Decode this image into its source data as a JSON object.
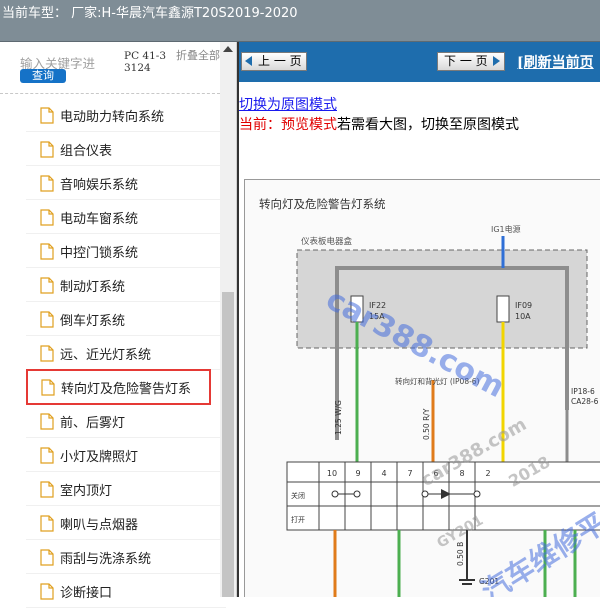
{
  "titlebar": {
    "title": "当前车型： 厂家:H-华晨汽车鑫源T20S2019-2020"
  },
  "sidebar": {
    "search": {
      "placeholder": "输入关键字进",
      "button": "查询",
      "code": "PC 41-33124",
      "collapse_all": "折叠全部"
    },
    "items": [
      {
        "label": "电动助力转向系统"
      },
      {
        "label": "组合仪表"
      },
      {
        "label": "音响娱乐系统"
      },
      {
        "label": "电动车窗系统"
      },
      {
        "label": "中控门锁系统"
      },
      {
        "label": "制动灯系统"
      },
      {
        "label": "倒车灯系统"
      },
      {
        "label": "远、近光灯系统"
      },
      {
        "label": "转向灯及危险警告灯系"
      },
      {
        "label": "前、后雾灯"
      },
      {
        "label": "小灯及牌照灯"
      },
      {
        "label": "室内顶灯"
      },
      {
        "label": "喇叭与点烟器"
      },
      {
        "label": "雨刮与洗涤系统"
      },
      {
        "label": "诊断接口"
      }
    ],
    "selected_index": 8
  },
  "viewer": {
    "prev_label": "上 一 页",
    "next_label": "下 一 页",
    "refresh_label": "[刷新当前页",
    "switch_link": "切换为原图模式",
    "mode_prefix": "当前：预览模式",
    "mode_suffix": "若需看大图，切换至原图模式"
  },
  "diagram": {
    "title": "转向灯及危险警告灯系统",
    "box_label": "仪表板电器盒",
    "power_label": "IG1电源",
    "fuse1": {
      "id": "IF22",
      "amp": "15A"
    },
    "fuse2": {
      "id": "IF09",
      "amp": "10A"
    },
    "connector1": "IP18-6",
    "connector2": "CA28-6",
    "wire1": "1.25 W/G",
    "wire2": "0.50 R/Y",
    "wire3": "0.50 B",
    "ground": "G201",
    "note": "转向灯和背光灯 (IP08-6)",
    "pins": [
      "10",
      "9",
      "4",
      "7",
      "6",
      "8",
      "2"
    ],
    "row_off": "关闭",
    "row_on": "打开",
    "watermarks": [
      "car388.com",
      "car388.com",
      "汽车维修平",
      "2018",
      "GY201"
    ]
  },
  "colors": {
    "titlebar": "#7f8d96",
    "nav": "#1e6dad",
    "query_button": "#1572c7",
    "selected_outline": "#e53935",
    "wire_green": "#4caf50",
    "wire_orange": "#e07b1a",
    "wire_yellow": "#f2d500",
    "wire_blue": "#2f6fd6"
  }
}
